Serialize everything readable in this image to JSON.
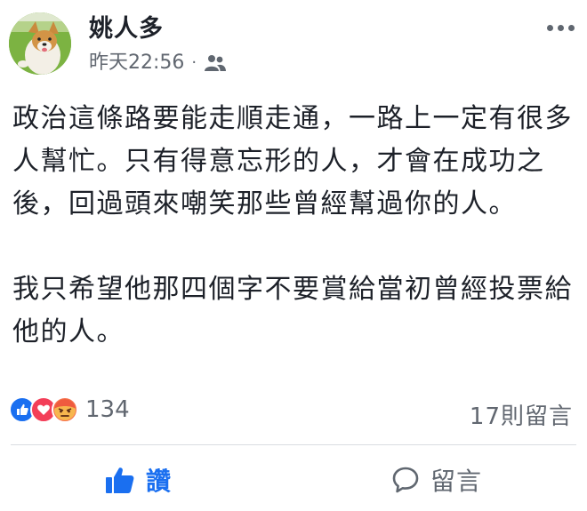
{
  "post": {
    "author": "姚人多",
    "timestamp": "昨天22:56",
    "separator": "·",
    "audience_icon": "friends-icon",
    "paragraphs": [
      "政治這條路要能走順走通，一路上一定有很多人幫忙。只有得意忘形的人，才會在成功之後，回過頭來嘲笑那些曾經幫過你的人。",
      "我只希望他那四個字不要賞給當初曾經投票給他的人。"
    ],
    "reactions": {
      "icons": [
        "like-icon",
        "love-icon",
        "angry-icon"
      ],
      "count": "134"
    },
    "comments_label": "17則留言"
  },
  "actions": {
    "like_label": "讚",
    "comment_label": "留言"
  },
  "colors": {
    "like_blue": "#1a6ff0",
    "love_red": "#f33e58",
    "angry_orange": "#f7714e",
    "secondary_text": "#616770"
  }
}
